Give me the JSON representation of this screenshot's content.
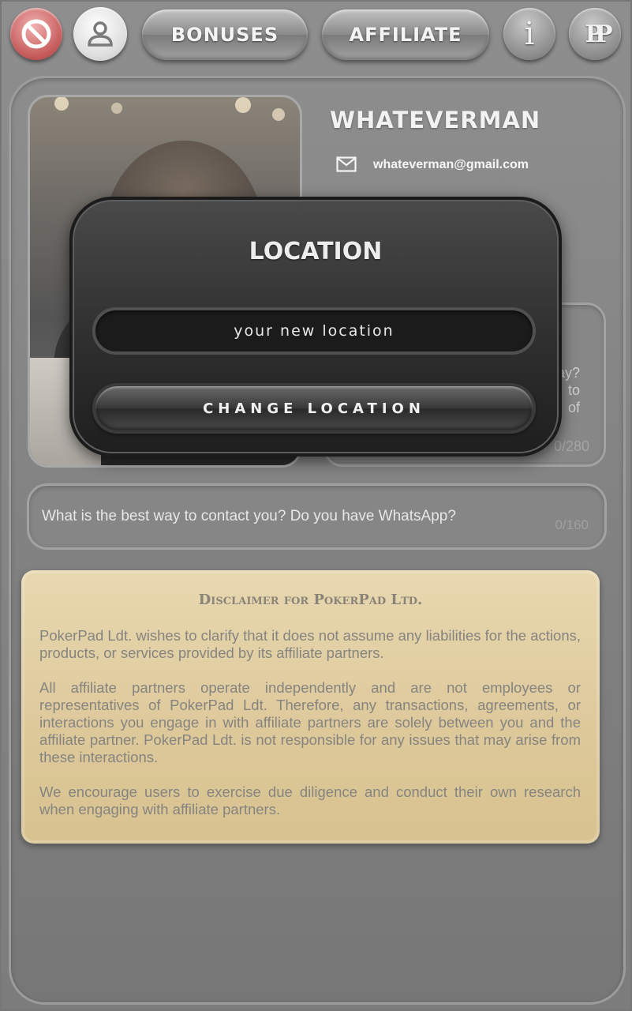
{
  "topbar": {
    "bonuses_label": "BONUSES",
    "affiliate_label": "AFFILIATE",
    "info_glyph": "i",
    "logo_glyph": "PP",
    "icons": [
      "ban-icon",
      "user-icon",
      "info-icon",
      "pokerpad-logo"
    ]
  },
  "profile": {
    "username": "WHATEVERMAN",
    "email": "whateverman@gmail.com",
    "about_snippet": "ay?\nto\nof",
    "about_count": "0/280",
    "contact_placeholder": "What is the best way to contact you? Do you have WhatsApp?",
    "contact_count": "0/160"
  },
  "disclaimer": {
    "title": "Disclaimer for PokerPad Ltd.",
    "paragraphs": [
      "PokerPad Ldt. wishes to clarify that it does not assume any liabilities for the actions, products, or services provided by its affiliate partners.",
      "All affiliate partners operate independently and are not employees or representatives of PokerPad Ldt. Therefore, any transactions, agreements, or interactions you engage in with affiliate partners are solely between you and the affiliate partner. PokerPad Ldt. is not responsible for any issues that may arise from these interactions.",
      "We encourage users to exercise due diligence and conduct their own research when engaging with affiliate partners."
    ]
  },
  "modal": {
    "title": "LOCATION",
    "input_placeholder": "your new location",
    "input_value": "",
    "button_label": "CHANGE LOCATION"
  },
  "colors": {
    "ban": "#c45858",
    "parchment": "#ddc89a",
    "modal_bg": "#2f2f2f"
  }
}
